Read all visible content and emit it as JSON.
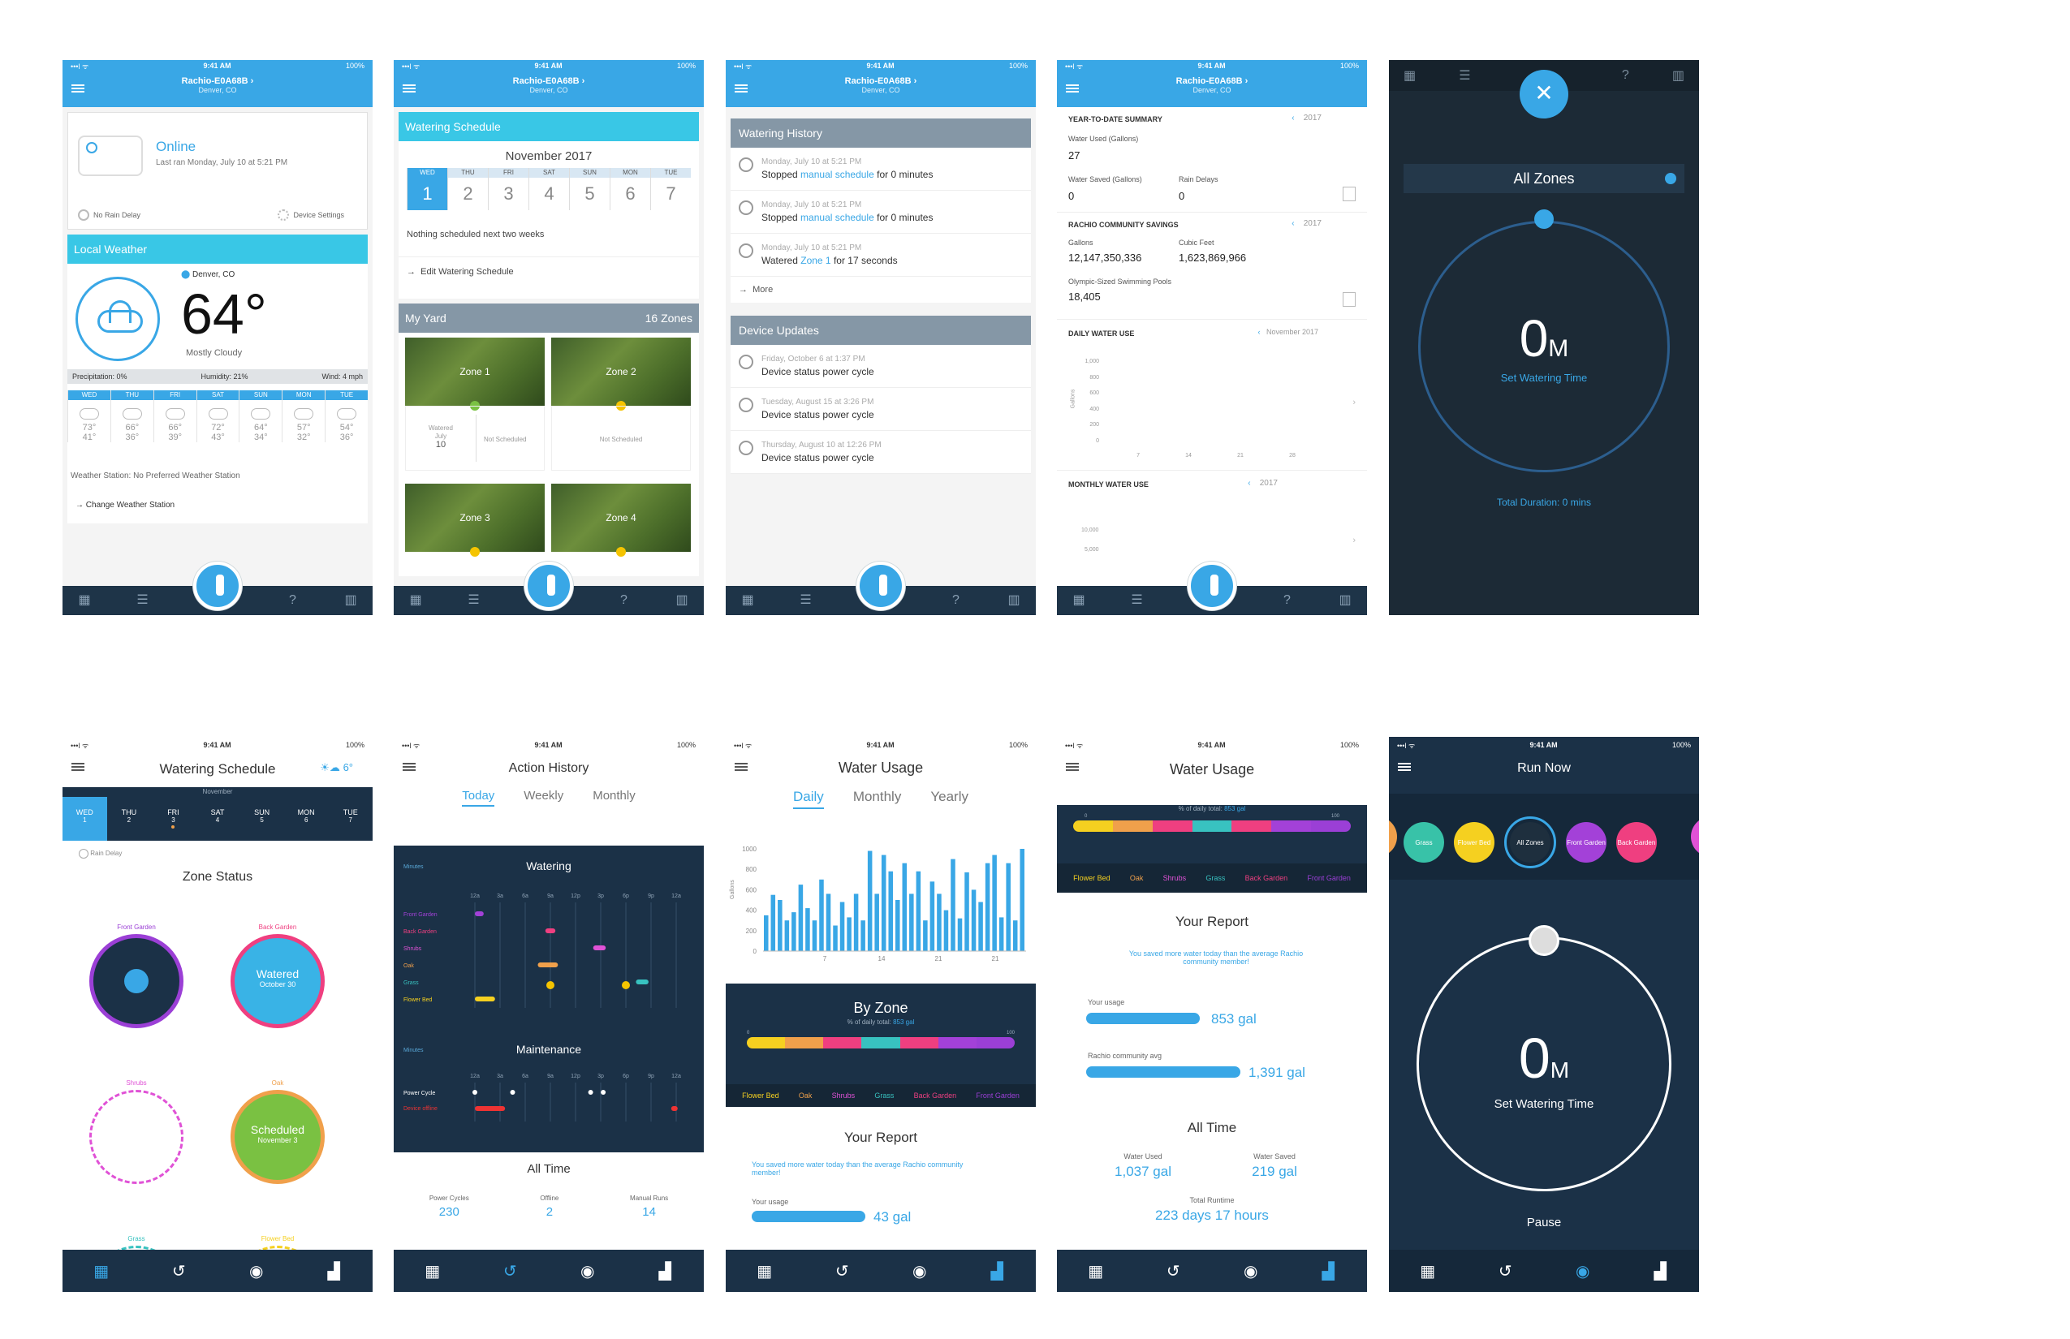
{
  "status_bar": {
    "carrier": "•••l ᯤ",
    "time": "9:41 AM",
    "battery": "100%"
  },
  "device": {
    "name": "Rachio-E0A68B",
    "location": "Denver, CO"
  },
  "dashboard": {
    "online": "Online",
    "last_ran": "Last ran Monday, July 10 at 5:21 PM",
    "no_rain_delay": "No Rain Delay",
    "device_settings": "Device Settings",
    "local_weather": "Local Weather",
    "city": "Denver, CO",
    "temp": "64°",
    "condition": "Mostly Cloudy",
    "precipitation": "Precipitation: 0%",
    "humidity": "Humidity: 21%",
    "wind": "Wind: 4 mph",
    "forecast": [
      {
        "day": "WED",
        "hi": "73°",
        "lo": "41°"
      },
      {
        "day": "THU",
        "hi": "66°",
        "lo": "36°"
      },
      {
        "day": "FRI",
        "hi": "66°",
        "lo": "39°"
      },
      {
        "day": "SAT",
        "hi": "72°",
        "lo": "43°"
      },
      {
        "day": "SUN",
        "hi": "64°",
        "lo": "34°"
      },
      {
        "day": "MON",
        "hi": "57°",
        "lo": "32°"
      },
      {
        "day": "TUE",
        "hi": "54°",
        "lo": "36°"
      }
    ],
    "weather_station": "Weather Station: No Preferred Weather Station",
    "change_station": "Change Weather Station"
  },
  "schedule": {
    "header": "Watering Schedule",
    "month": "November 2017",
    "days": [
      {
        "n": "WED",
        "v": "1"
      },
      {
        "n": "THU",
        "v": "2"
      },
      {
        "n": "FRI",
        "v": "3"
      },
      {
        "n": "SAT",
        "v": "4"
      },
      {
        "n": "SUN",
        "v": "5"
      },
      {
        "n": "MON",
        "v": "6"
      },
      {
        "n": "TUE",
        "v": "7"
      }
    ],
    "nothing": "Nothing scheduled next two weeks",
    "edit": "Edit Watering Schedule",
    "yard": "My Yard",
    "zones_count": "16 Zones",
    "zones": [
      "Zone 1",
      "Zone 2",
      "Zone 3",
      "Zone 4"
    ],
    "watered_label": "Watered",
    "watered_date": "July",
    "watered_day": "10",
    "not_scheduled": "Not Scheduled"
  },
  "history": {
    "header": "Watering History",
    "items": [
      {
        "t": "Monday, July 10 at 5:21 PM",
        "a": "Stopped ",
        "l": "manual schedule",
        "b": " for 0 minutes"
      },
      {
        "t": "Monday, July 10 at 5:21 PM",
        "a": "Stopped ",
        "l": "manual schedule",
        "b": " for 0 minutes"
      },
      {
        "t": "Monday, July 10 at 5:21 PM",
        "a": "Watered ",
        "l": "Zone 1",
        "b": " for 17 seconds"
      }
    ],
    "more": "More",
    "updates_header": "Device Updates",
    "updates": [
      {
        "t": "Friday, October 6 at 1:37 PM",
        "a": "Device status power cycle"
      },
      {
        "t": "Tuesday, August 15 at 3:26 PM",
        "a": "Device status power cycle"
      },
      {
        "t": "Thursday, August 10 at 12:26 PM",
        "a": "Device status power cycle"
      }
    ]
  },
  "summary": {
    "ytd": "YEAR-TO-DATE SUMMARY",
    "year": "2017",
    "water_used_label": "Water Used (Gallons)",
    "water_used": "27",
    "water_saved_label": "Water Saved (Gallons)",
    "water_saved": "0",
    "rain_delays_label": "Rain Delays",
    "rain_delays": "0",
    "community": "RACHIO COMMUNITY SAVINGS",
    "gallons_label": "Gallons",
    "gallons": "12,147,350,336",
    "cubic_label": "Cubic Feet",
    "cubic": "1,623,869,966",
    "pools_label": "Olympic-Sized Swimming Pools",
    "pools": "18,405",
    "daily": "DAILY WATER USE",
    "daily_period": "November 2017",
    "daily_ticks": [
      "1,000",
      "800",
      "600",
      "400",
      "200",
      "0"
    ],
    "daily_x": [
      "7",
      "14",
      "21",
      "28"
    ],
    "gallons_axis": "Gallons",
    "monthly": "MONTHLY WATER USE",
    "monthly_ticks": [
      "10,000",
      "5,000"
    ]
  },
  "run_old": {
    "all_zones": "All Zones",
    "time": "0",
    "unit": "M",
    "set": "Set Watering Time",
    "total": "Total Duration: 0 mins"
  },
  "new_schedule": {
    "title": "Watering Schedule",
    "weather": "6°",
    "month": "November",
    "days": [
      {
        "n": "WED",
        "v": "1"
      },
      {
        "n": "THU",
        "v": "2"
      },
      {
        "n": "FRI",
        "v": "3"
      },
      {
        "n": "SAT",
        "v": "4"
      },
      {
        "n": "SUN",
        "v": "5"
      },
      {
        "n": "MON",
        "v": "6"
      },
      {
        "n": "TUE",
        "v": "7"
      }
    ],
    "rain_delay": "Rain Delay",
    "zone_status": "Zone Status",
    "zones": [
      {
        "name": "Front Garden",
        "color": "#9b3fd6"
      },
      {
        "name": "Back Garden",
        "color": "#ef3f80",
        "state": "Watered",
        "date": "October 30"
      },
      {
        "name": "Shrubs",
        "color": "#e052d6"
      },
      {
        "name": "Oak",
        "color": "#f0a04b",
        "state": "Scheduled",
        "date": "November 3"
      },
      {
        "name": "Grass",
        "color": "#38c2c0"
      },
      {
        "name": "Flower Bed",
        "color": "#f5d020"
      }
    ]
  },
  "action_history": {
    "title": "Action History",
    "tabs": [
      "Today",
      "Weekly",
      "Monthly"
    ],
    "watering": "Watering",
    "maintenance": "Maintenance",
    "minutes": "Minutes",
    "hours": [
      "12a",
      "3a",
      "6a",
      "9a",
      "12p",
      "3p",
      "6p",
      "9p",
      "12a"
    ],
    "zones": [
      "Front Garden",
      "Back Garden",
      "Shrubs",
      "Oak",
      "Grass",
      "Flower Bed"
    ],
    "maint_rows": [
      "Power Cycle",
      "Device offline"
    ],
    "all_time": "All Time",
    "stats": [
      {
        "label": "Power Cycles",
        "value": "230"
      },
      {
        "label": "Offline",
        "value": "2"
      },
      {
        "label": "Manual Runs",
        "value": "14"
      }
    ]
  },
  "water_usage": {
    "title": "Water Usage",
    "tabs": [
      "Daily",
      "Monthly",
      "Yearly"
    ],
    "y_ticks": [
      "1000",
      "800",
      "600",
      "400",
      "200",
      "0"
    ],
    "x_ticks": [
      "7",
      "14",
      "21",
      "21"
    ],
    "gallons_axis": "Gallons",
    "by_zone": "By Zone",
    "pct_label": "% of daily total:",
    "pct_value": "853 gal",
    "stack_scale": [
      "0",
      "100"
    ],
    "legend": [
      {
        "n": "Flower Bed",
        "c": "#f5d020"
      },
      {
        "n": "Oak",
        "c": "#f0a04b"
      },
      {
        "n": "Shrubs",
        "c": "#e052d6"
      },
      {
        "n": "Grass",
        "c": "#38c2c0"
      },
      {
        "n": "Back Garden",
        "c": "#ef3f80"
      },
      {
        "n": "Front Garden",
        "c": "#9b3fd6"
      }
    ],
    "report": "Your Report",
    "saved": "You saved more water today than the average Rachio community member!",
    "your_usage": "Your usage",
    "your_value": "43 gal",
    "community_avg": "Rachio community avg",
    "your_value2": "853 gal",
    "community_value": "1,391 gal",
    "all_time": "All Time",
    "water_used_label": "Water Used",
    "water_used": "1,037 gal",
    "water_saved_label": "Water Saved",
    "water_saved": "219 gal",
    "runtime_label": "Total Runtime",
    "runtime": "223 days 17 hours"
  },
  "chart_data": {
    "type": "bar",
    "title": "Daily",
    "ylabel": "Gallons",
    "ylim": [
      0,
      1000
    ],
    "values": [
      350,
      550,
      500,
      300,
      380,
      650,
      420,
      300,
      700,
      560,
      250,
      480,
      330,
      560,
      300,
      980,
      560,
      940,
      780,
      500,
      860,
      560,
      780,
      300,
      680,
      560,
      400,
      900,
      320,
      770,
      600,
      480,
      860,
      940,
      330,
      860,
      300,
      1000
    ],
    "x_ticks": [
      "7",
      "14",
      "21",
      "21"
    ]
  },
  "run_now": {
    "title": "Run Now",
    "zones": [
      {
        "n": "Grass",
        "c": "#38c2a8"
      },
      {
        "n": "Flower Bed",
        "c": "#f5d020"
      },
      {
        "n": "All Zones",
        "c": "#1e2f3e"
      },
      {
        "n": "Front Garden",
        "c": "#a341d8"
      },
      {
        "n": "Back Garden",
        "c": "#ef3f80"
      }
    ],
    "time": "0",
    "unit": "M",
    "set": "Set Watering Time",
    "pause": "Pause"
  }
}
